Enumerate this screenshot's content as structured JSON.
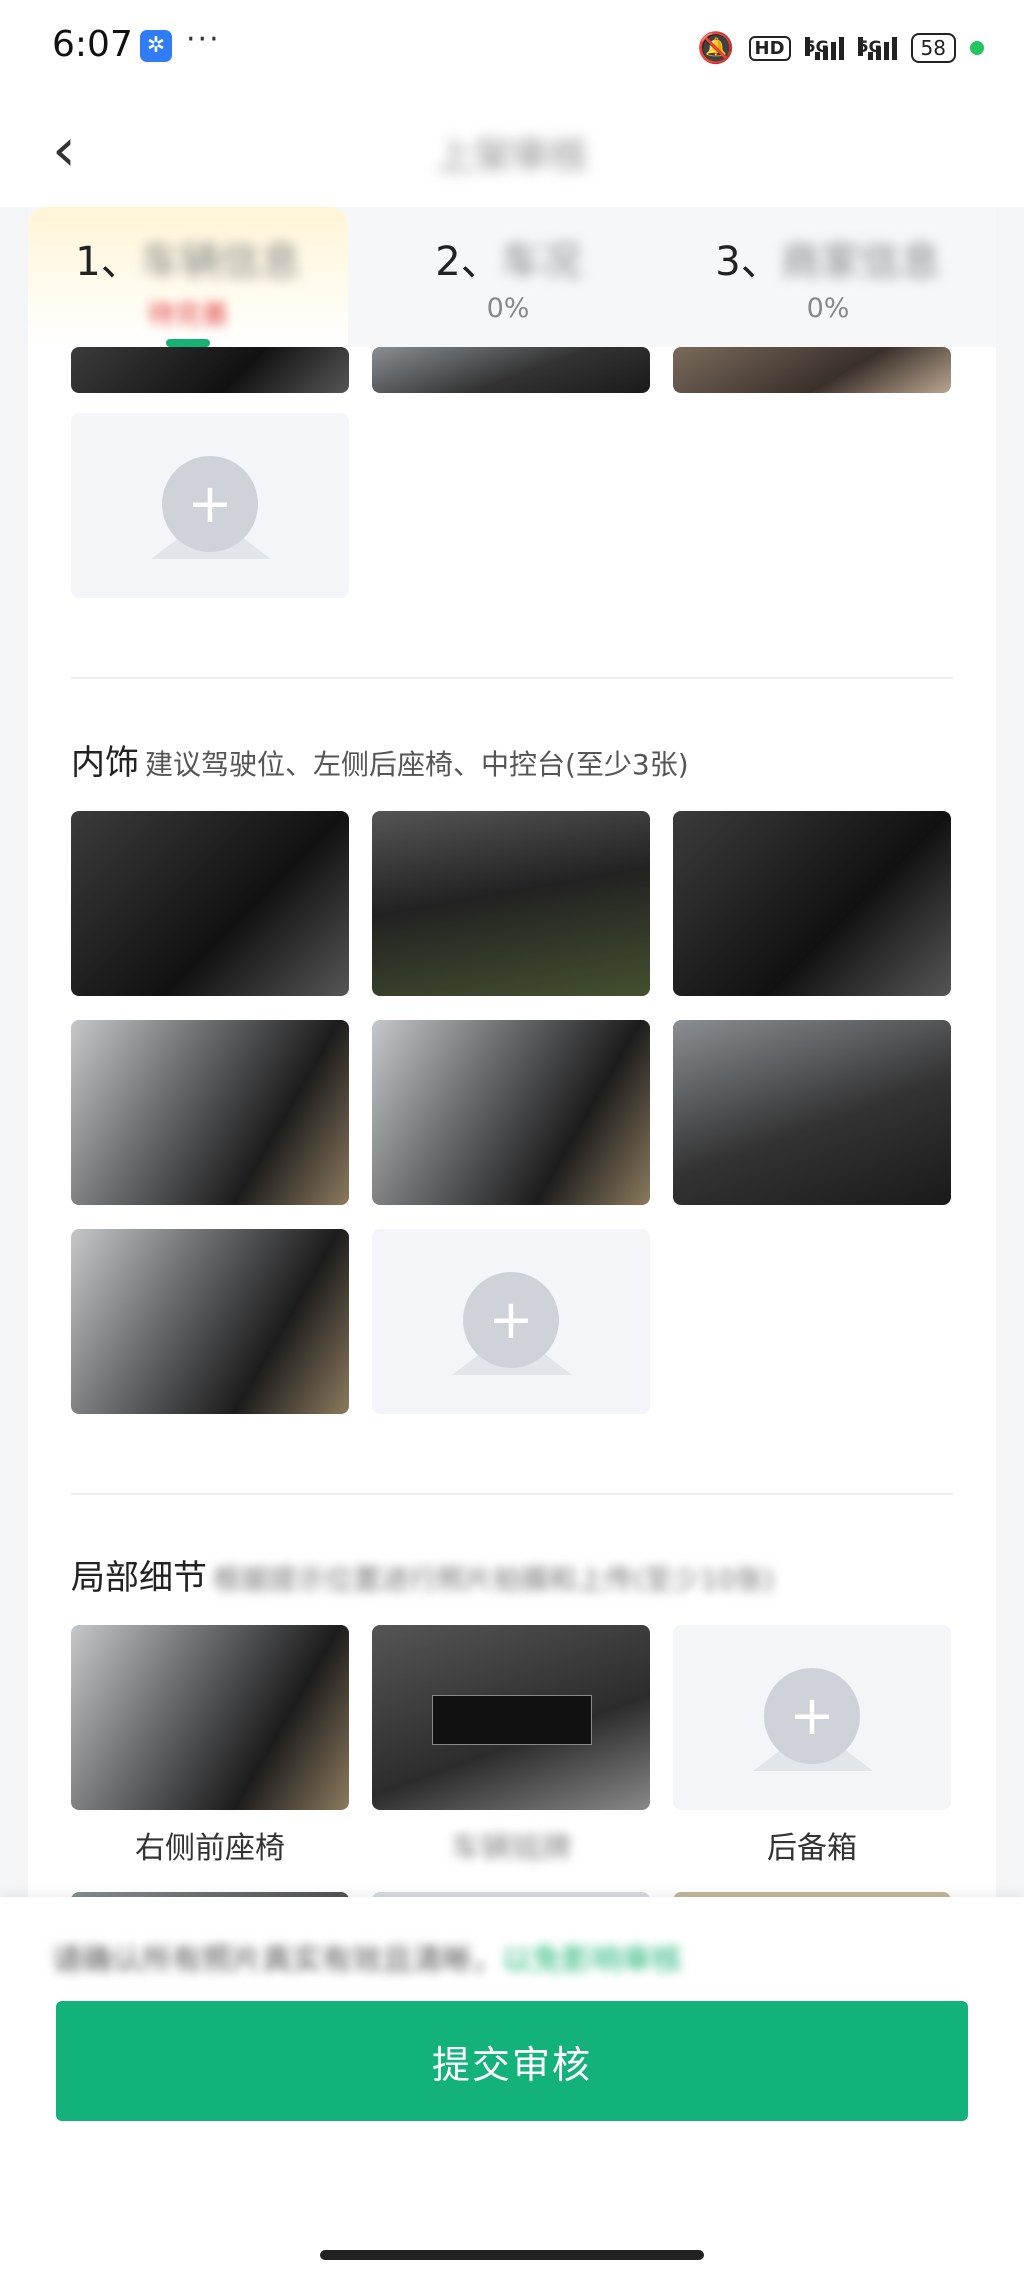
{
  "status_bar": {
    "time": "6:07",
    "more": "···",
    "network": "5G",
    "hd": "HD",
    "battery": "58"
  },
  "header": {
    "title": "上架审核"
  },
  "tabs": [
    {
      "label_prefix": "1、",
      "label_rest": "车辆信息",
      "sub": "待完善"
    },
    {
      "label_prefix": "2、",
      "label_rest": "车况",
      "sub": "0%"
    },
    {
      "label_prefix": "3、",
      "label_rest": "商家信息",
      "sub": "0%"
    }
  ],
  "sections": {
    "interior": {
      "title": "内饰",
      "hint": "建议驾驶位、左侧后座椅、中控台(至少3张)"
    },
    "details": {
      "title": "局部细节",
      "hint": "根据提示位置进行照片拍摄和上传(至少10张)",
      "captions": [
        "右侧前座椅",
        "车辆铭牌",
        "后备箱"
      ]
    }
  },
  "add_photo_symbol": "+",
  "footer": {
    "notice_main": "请确认所有照片真实有效且清晰，",
    "notice_green": "以免影响审核",
    "submit_label": "提交审核"
  }
}
